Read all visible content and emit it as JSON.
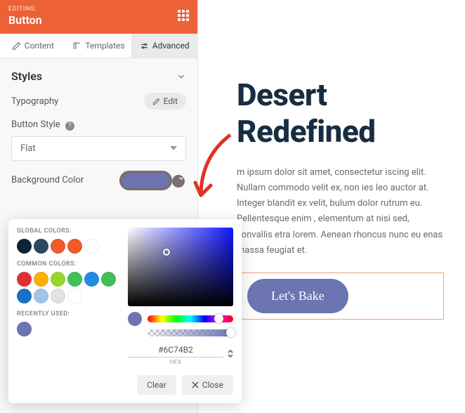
{
  "header": {
    "editing_label": "EDITING:",
    "element": "Button"
  },
  "tabs": {
    "content": "Content",
    "templates": "Templates",
    "advanced": "Advanced"
  },
  "styles": {
    "heading": "Styles",
    "typography_label": "Typography",
    "edit_label": "Edit",
    "button_style_label": "Button Style",
    "button_style_value": "Flat",
    "bg_color_label": "Background Color",
    "bg_color_value": "#6C74B2"
  },
  "picker": {
    "global_label": "GLOBAL COLORS:",
    "global": [
      "#0d2436",
      "#2a4a61",
      "#f15a29",
      "#f15a29",
      "#ffffff"
    ],
    "common_label": "COMMON COLORS:",
    "common": [
      "#e03131",
      "#fab005",
      "#94d82d",
      "#40c057",
      "#228be6",
      "#40c057",
      "#1971c2",
      "#9fc6e7",
      "#e2e2e2",
      "#ffffff"
    ],
    "recent_label": "RECENTLY USED:",
    "recent": [
      "#6c74b2"
    ],
    "hex_value": "#6C74B2",
    "hex_label": "HEX",
    "clear": "Clear",
    "close": "Close",
    "current": "#6c74b2"
  },
  "preview": {
    "title_line1": "Desert",
    "title_line2": "Redefined",
    "body": "m ipsum dolor sit amet, consectetur iscing elit. Nullam commodo velit ex, non ies leo auctor at. Integer blandit ex velit, bulum dolor rutrum eu. Pellentesque enim , elementum at nisi sed, convallis etra lorem. Aenean rhoncus nunc eu enas massa feugiat et.",
    "cta": "Let's Bake"
  }
}
